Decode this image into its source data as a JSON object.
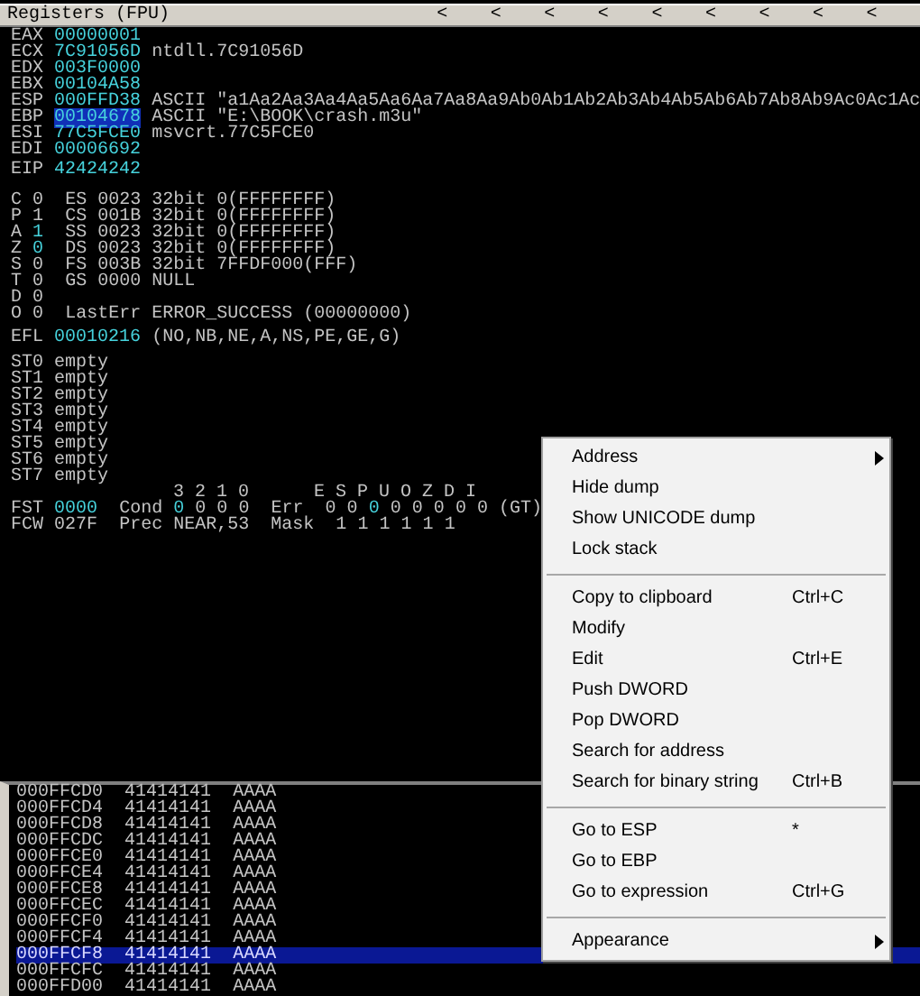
{
  "registers_pane": {
    "title": "Registers (FPU)",
    "title_arrows": [
      "<",
      "<",
      "<",
      "<",
      "<",
      "<",
      "<",
      "<",
      "<"
    ],
    "registers": [
      {
        "name": "EAX",
        "value": "00000001",
        "changed": true,
        "selected": false
      },
      {
        "name": "ECX",
        "value": "7C91056D",
        "changed": true,
        "selected": false,
        "comment": "ntdll.7C91056D"
      },
      {
        "name": "EDX",
        "value": "003F0000",
        "changed": true,
        "selected": false
      },
      {
        "name": "EBX",
        "value": "00104A58",
        "changed": true,
        "selected": false
      },
      {
        "name": "ESP",
        "value": "000FFD38",
        "changed": true,
        "selected": false,
        "comment": "ASCII \"a1Aa2Aa3Aa4Aa5Aa6Aa7Aa8Aa9Ab0Ab1Ab2Ab3Ab4Ab5Ab6Ab7Ab8Ab9Ac0Ac1Ac"
      },
      {
        "name": "EBP",
        "value": "00104678",
        "changed": true,
        "selected": true,
        "comment": "ASCII \"E:\\BOOK\\crash.m3u\""
      },
      {
        "name": "ESI",
        "value": "77C5FCE0",
        "changed": true,
        "selected": false,
        "comment": "msvcrt.77C5FCE0"
      },
      {
        "name": "EDI",
        "value": "00006692",
        "changed": true,
        "selected": false
      }
    ],
    "eip": {
      "name": "EIP",
      "value": "42424242",
      "changed": true
    },
    "flags": [
      {
        "flag": "C",
        "bit": "0",
        "changed": false,
        "info": "ES 0023 32bit 0(FFFFFFFF)"
      },
      {
        "flag": "P",
        "bit": "1",
        "changed": false,
        "info": "CS 001B 32bit 0(FFFFFFFF)"
      },
      {
        "flag": "A",
        "bit": "1",
        "changed": true,
        "info": "SS 0023 32bit 0(FFFFFFFF)"
      },
      {
        "flag": "Z",
        "bit": "0",
        "changed": true,
        "info": "DS 0023 32bit 0(FFFFFFFF)"
      },
      {
        "flag": "S",
        "bit": "0",
        "changed": false,
        "info": "FS 003B 32bit 7FFDF000(FFF)"
      },
      {
        "flag": "T",
        "bit": "0",
        "changed": false,
        "info": "GS 0000 NULL"
      },
      {
        "flag": "D",
        "bit": "0",
        "changed": false
      },
      {
        "flag": "O",
        "bit": "0",
        "changed": false,
        "info": "LastErr ERROR_SUCCESS (00000000)"
      }
    ],
    "efl": {
      "name": "EFL",
      "value": "00010216",
      "changed": true,
      "decoded": "(NO,NB,NE,A,NS,PE,GE,G)"
    },
    "fpu_stack": [
      {
        "name": "ST0",
        "value": "empty"
      },
      {
        "name": "ST1",
        "value": "empty"
      },
      {
        "name": "ST2",
        "value": "empty"
      },
      {
        "name": "ST3",
        "value": "empty"
      },
      {
        "name": "ST4",
        "value": "empty"
      },
      {
        "name": "ST5",
        "value": "empty"
      },
      {
        "name": "ST6",
        "value": "empty"
      },
      {
        "name": "ST7",
        "value": "empty"
      }
    ],
    "cond_header": "3 2 1 0",
    "err_header": "E S P U O Z D I",
    "fst": {
      "name": "FST",
      "value": "0000",
      "changed": true,
      "cond_label": "Cond",
      "cond_bits": [
        {
          "value": "0",
          "changed": true
        },
        {
          "value": "0",
          "changed": false
        },
        {
          "value": "0",
          "changed": false
        },
        {
          "value": "0",
          "changed": false
        }
      ],
      "err_label": "Err",
      "err_bits": [
        {
          "value": "0",
          "changed": false
        },
        {
          "value": "0",
          "changed": false
        },
        {
          "value": "0",
          "changed": true
        },
        {
          "value": "0",
          "changed": false
        },
        {
          "value": "0",
          "changed": false
        },
        {
          "value": "0",
          "changed": false
        },
        {
          "value": "0",
          "changed": false
        },
        {
          "value": "0",
          "changed": false
        }
      ],
      "compare": "(GT)"
    },
    "fcw": {
      "name": "FCW",
      "value": "027F",
      "prec_label": "Prec",
      "prec": "NEAR,53",
      "mask_label": "Mask",
      "mask_bits": [
        "1",
        "1",
        "1",
        "1",
        "1",
        "1"
      ]
    }
  },
  "stack_pane": {
    "rows": [
      {
        "address": "000FFCD0",
        "value": "41414141",
        "ascii": "AAAA",
        "selected": false
      },
      {
        "address": "000FFCD4",
        "value": "41414141",
        "ascii": "AAAA",
        "selected": false
      },
      {
        "address": "000FFCD8",
        "value": "41414141",
        "ascii": "AAAA",
        "selected": false
      },
      {
        "address": "000FFCDC",
        "value": "41414141",
        "ascii": "AAAA",
        "selected": false
      },
      {
        "address": "000FFCE0",
        "value": "41414141",
        "ascii": "AAAA",
        "selected": false
      },
      {
        "address": "000FFCE4",
        "value": "41414141",
        "ascii": "AAAA",
        "selected": false
      },
      {
        "address": "000FFCE8",
        "value": "41414141",
        "ascii": "AAAA",
        "selected": false
      },
      {
        "address": "000FFCEC",
        "value": "41414141",
        "ascii": "AAAA",
        "selected": false
      },
      {
        "address": "000FFCF0",
        "value": "41414141",
        "ascii": "AAAA",
        "selected": false
      },
      {
        "address": "000FFCF4",
        "value": "41414141",
        "ascii": "AAAA",
        "selected": false
      },
      {
        "address": "000FFCF8",
        "value": "41414141",
        "ascii": "AAAA",
        "selected": true
      },
      {
        "address": "000FFCFC",
        "value": "41414141",
        "ascii": "AAAA",
        "selected": false
      },
      {
        "address": "000FFD00",
        "value": "41414141",
        "ascii": "AAAA",
        "selected": false
      }
    ]
  },
  "context_menu": {
    "items": [
      {
        "kind": "item",
        "label": "Address",
        "submenu": true
      },
      {
        "kind": "item",
        "label": "Hide dump"
      },
      {
        "kind": "item",
        "label": "Show UNICODE dump"
      },
      {
        "kind": "item",
        "label": "Lock stack"
      },
      {
        "kind": "separator"
      },
      {
        "kind": "item",
        "label": "Copy to clipboard",
        "shortcut": "Ctrl+C"
      },
      {
        "kind": "item",
        "label": "Modify"
      },
      {
        "kind": "item",
        "label": "Edit",
        "shortcut": "Ctrl+E"
      },
      {
        "kind": "item",
        "label": "Push DWORD"
      },
      {
        "kind": "item",
        "label": "Pop DWORD"
      },
      {
        "kind": "item",
        "label": "Search for address"
      },
      {
        "kind": "item",
        "label": "Search for binary string",
        "shortcut": "Ctrl+B"
      },
      {
        "kind": "separator"
      },
      {
        "kind": "item",
        "label": "Go to ESP",
        "shortcut": "*"
      },
      {
        "kind": "item",
        "label": "Go to EBP"
      },
      {
        "kind": "item",
        "label": "Go to expression",
        "shortcut": "Ctrl+G"
      },
      {
        "kind": "separator"
      },
      {
        "kind": "item",
        "label": "Appearance",
        "submenu": true
      }
    ]
  }
}
